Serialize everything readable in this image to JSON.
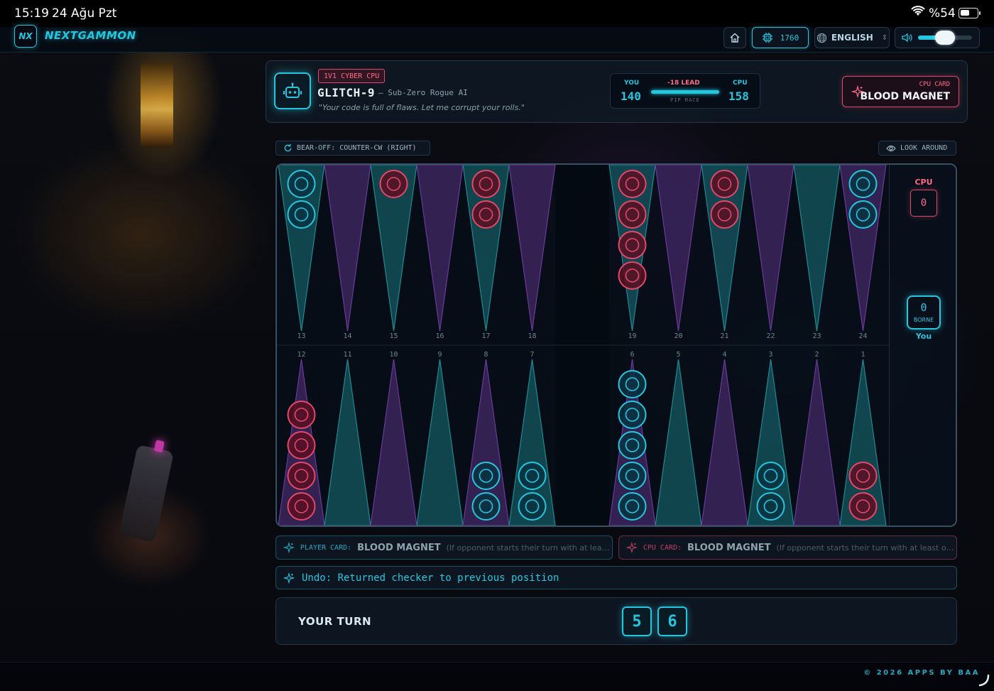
{
  "status_bar": {
    "time": "15:19",
    "date": "24 Ağu Pzt",
    "battery": "%54"
  },
  "nav": {
    "logo_mark": "NX",
    "logo_text": "NEXTGAMMON",
    "coins": "1760",
    "language": "ENGLISH",
    "volume_level": 0.5
  },
  "opponent": {
    "mode": "1V1 CYBER CPU",
    "name": "GLITCH-9",
    "subtitle": "— Sub-Zero Rogue AI",
    "quote": "\"Your code is full of flaws. Let me corrupt your rolls.\""
  },
  "pip": {
    "you_label": "YOU",
    "you_value": "140",
    "lead": "-18 LEAD",
    "race_label": "PIP RACE",
    "cpu_label": "CPU",
    "cpu_value": "158"
  },
  "cpu_card": {
    "label": "CPU CARD",
    "name": "BLOOD MAGNET"
  },
  "board_info": {
    "bearoff": "BEAR-OFF: COUNTER-CW (RIGHT)",
    "look_around": "LOOK AROUND"
  },
  "board": {
    "top_numbers": [
      "13",
      "14",
      "15",
      "16",
      "17",
      "18",
      "19",
      "20",
      "21",
      "22",
      "23",
      "24"
    ],
    "bottom_numbers": [
      "12",
      "11",
      "10",
      "9",
      "8",
      "7",
      "6",
      "5",
      "4",
      "3",
      "2",
      "1"
    ],
    "top_checkers": [
      {
        "color": "cyan",
        "count": 2
      },
      {
        "color": "none",
        "count": 0
      },
      {
        "color": "pink",
        "count": 1
      },
      {
        "color": "none",
        "count": 0
      },
      {
        "color": "pink",
        "count": 2
      },
      {
        "color": "none",
        "count": 0
      },
      {
        "color": "pink",
        "count": 4
      },
      {
        "color": "none",
        "count": 0
      },
      {
        "color": "pink",
        "count": 2
      },
      {
        "color": "none",
        "count": 0
      },
      {
        "color": "none",
        "count": 0
      },
      {
        "color": "cyan",
        "count": 2
      }
    ],
    "bottom_checkers": [
      {
        "color": "pink",
        "count": 4
      },
      {
        "color": "none",
        "count": 0
      },
      {
        "color": "none",
        "count": 0
      },
      {
        "color": "none",
        "count": 0
      },
      {
        "color": "cyan",
        "count": 2
      },
      {
        "color": "cyan",
        "count": 2
      },
      {
        "color": "cyan",
        "count": 5
      },
      {
        "color": "none",
        "count": 0
      },
      {
        "color": "none",
        "count": 0
      },
      {
        "color": "cyan",
        "count": 2
      },
      {
        "color": "none",
        "count": 0
      },
      {
        "color": "pink",
        "count": 2
      }
    ],
    "cpu_label": "CPU",
    "cpu_borne": "0",
    "you_borne": "0",
    "borne_label": "BORNE",
    "you_label": "You"
  },
  "cards": {
    "player_tag": "PLAYER CARD:",
    "player_name": "BLOOD MAGNET",
    "player_desc": "(If opponent starts their turn with at leas...",
    "cpu_tag": "CPU CARD:",
    "cpu_name": "BLOOD MAGNET",
    "cpu_desc": "(If opponent starts their turn with at least on..."
  },
  "log": {
    "message": "Undo: Returned checker to previous position"
  },
  "turn": {
    "label": "YOUR TURN",
    "die1": "5",
    "die2": "6"
  },
  "footer": {
    "copyright": "© 2026 APPS BY BAA"
  },
  "colors": {
    "cyan": "#25c7e0",
    "pink": "#e04a6a",
    "tri_cyan": "#1f8a92",
    "tri_purple": "#6a3a9a"
  }
}
